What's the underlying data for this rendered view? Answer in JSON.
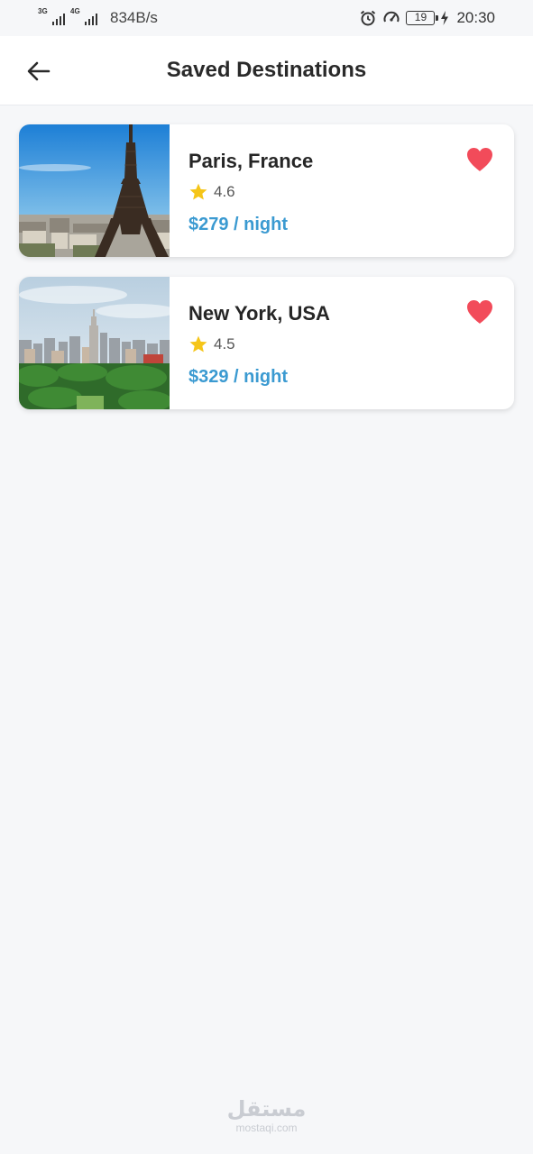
{
  "status_bar": {
    "network_1": "3G",
    "network_2": "4G",
    "speed": "834B/s",
    "battery": "19",
    "time": "20:30"
  },
  "app_bar": {
    "title": "Saved Destinations",
    "back_icon": "arrow-left-icon"
  },
  "destinations": [
    {
      "name": "Paris, France",
      "rating": "4.6",
      "price": "$279 / night",
      "favorite": true,
      "image": "eiffel-tower-photo"
    },
    {
      "name": "New York, USA",
      "rating": "4.5",
      "price": "$329 / night",
      "favorite": true,
      "image": "new-york-skyline-photo"
    }
  ],
  "colors": {
    "price": "#3b9ad1",
    "heart": "#f24b5a",
    "star": "#f5c518",
    "background": "#f6f7f9"
  },
  "watermark": {
    "arabic": "مستقل",
    "latin": "mostaqi.com"
  }
}
